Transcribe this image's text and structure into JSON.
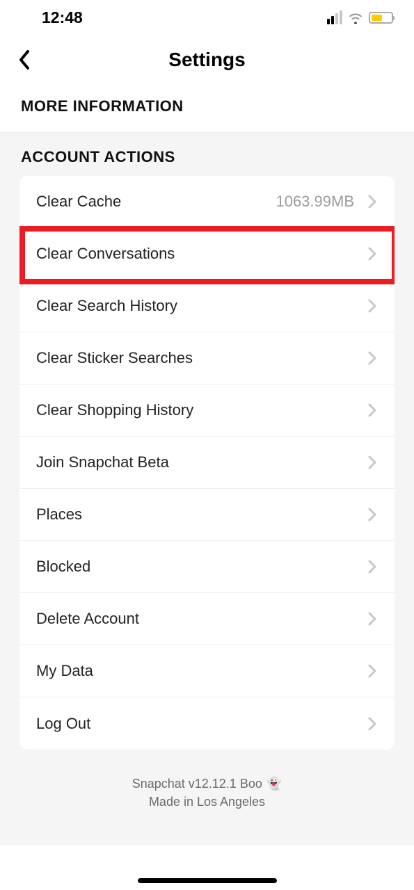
{
  "status": {
    "time": "12:48"
  },
  "header": {
    "title": "Settings"
  },
  "section_more_info": {
    "title": "MORE INFORMATION"
  },
  "section_account": {
    "title": "ACCOUNT ACTIONS",
    "items": [
      {
        "label": "Clear Cache",
        "value": "1063.99MB"
      },
      {
        "label": "Clear Conversations"
      },
      {
        "label": "Clear Search History"
      },
      {
        "label": "Clear Sticker Searches"
      },
      {
        "label": "Clear Shopping History"
      },
      {
        "label": "Join Snapchat Beta"
      },
      {
        "label": "Places"
      },
      {
        "label": "Blocked"
      },
      {
        "label": "Delete Account"
      },
      {
        "label": "My Data"
      },
      {
        "label": "Log Out"
      }
    ]
  },
  "footer": {
    "line1": "Snapchat v12.12.1 Boo",
    "line2": "Made in Los Angeles"
  }
}
